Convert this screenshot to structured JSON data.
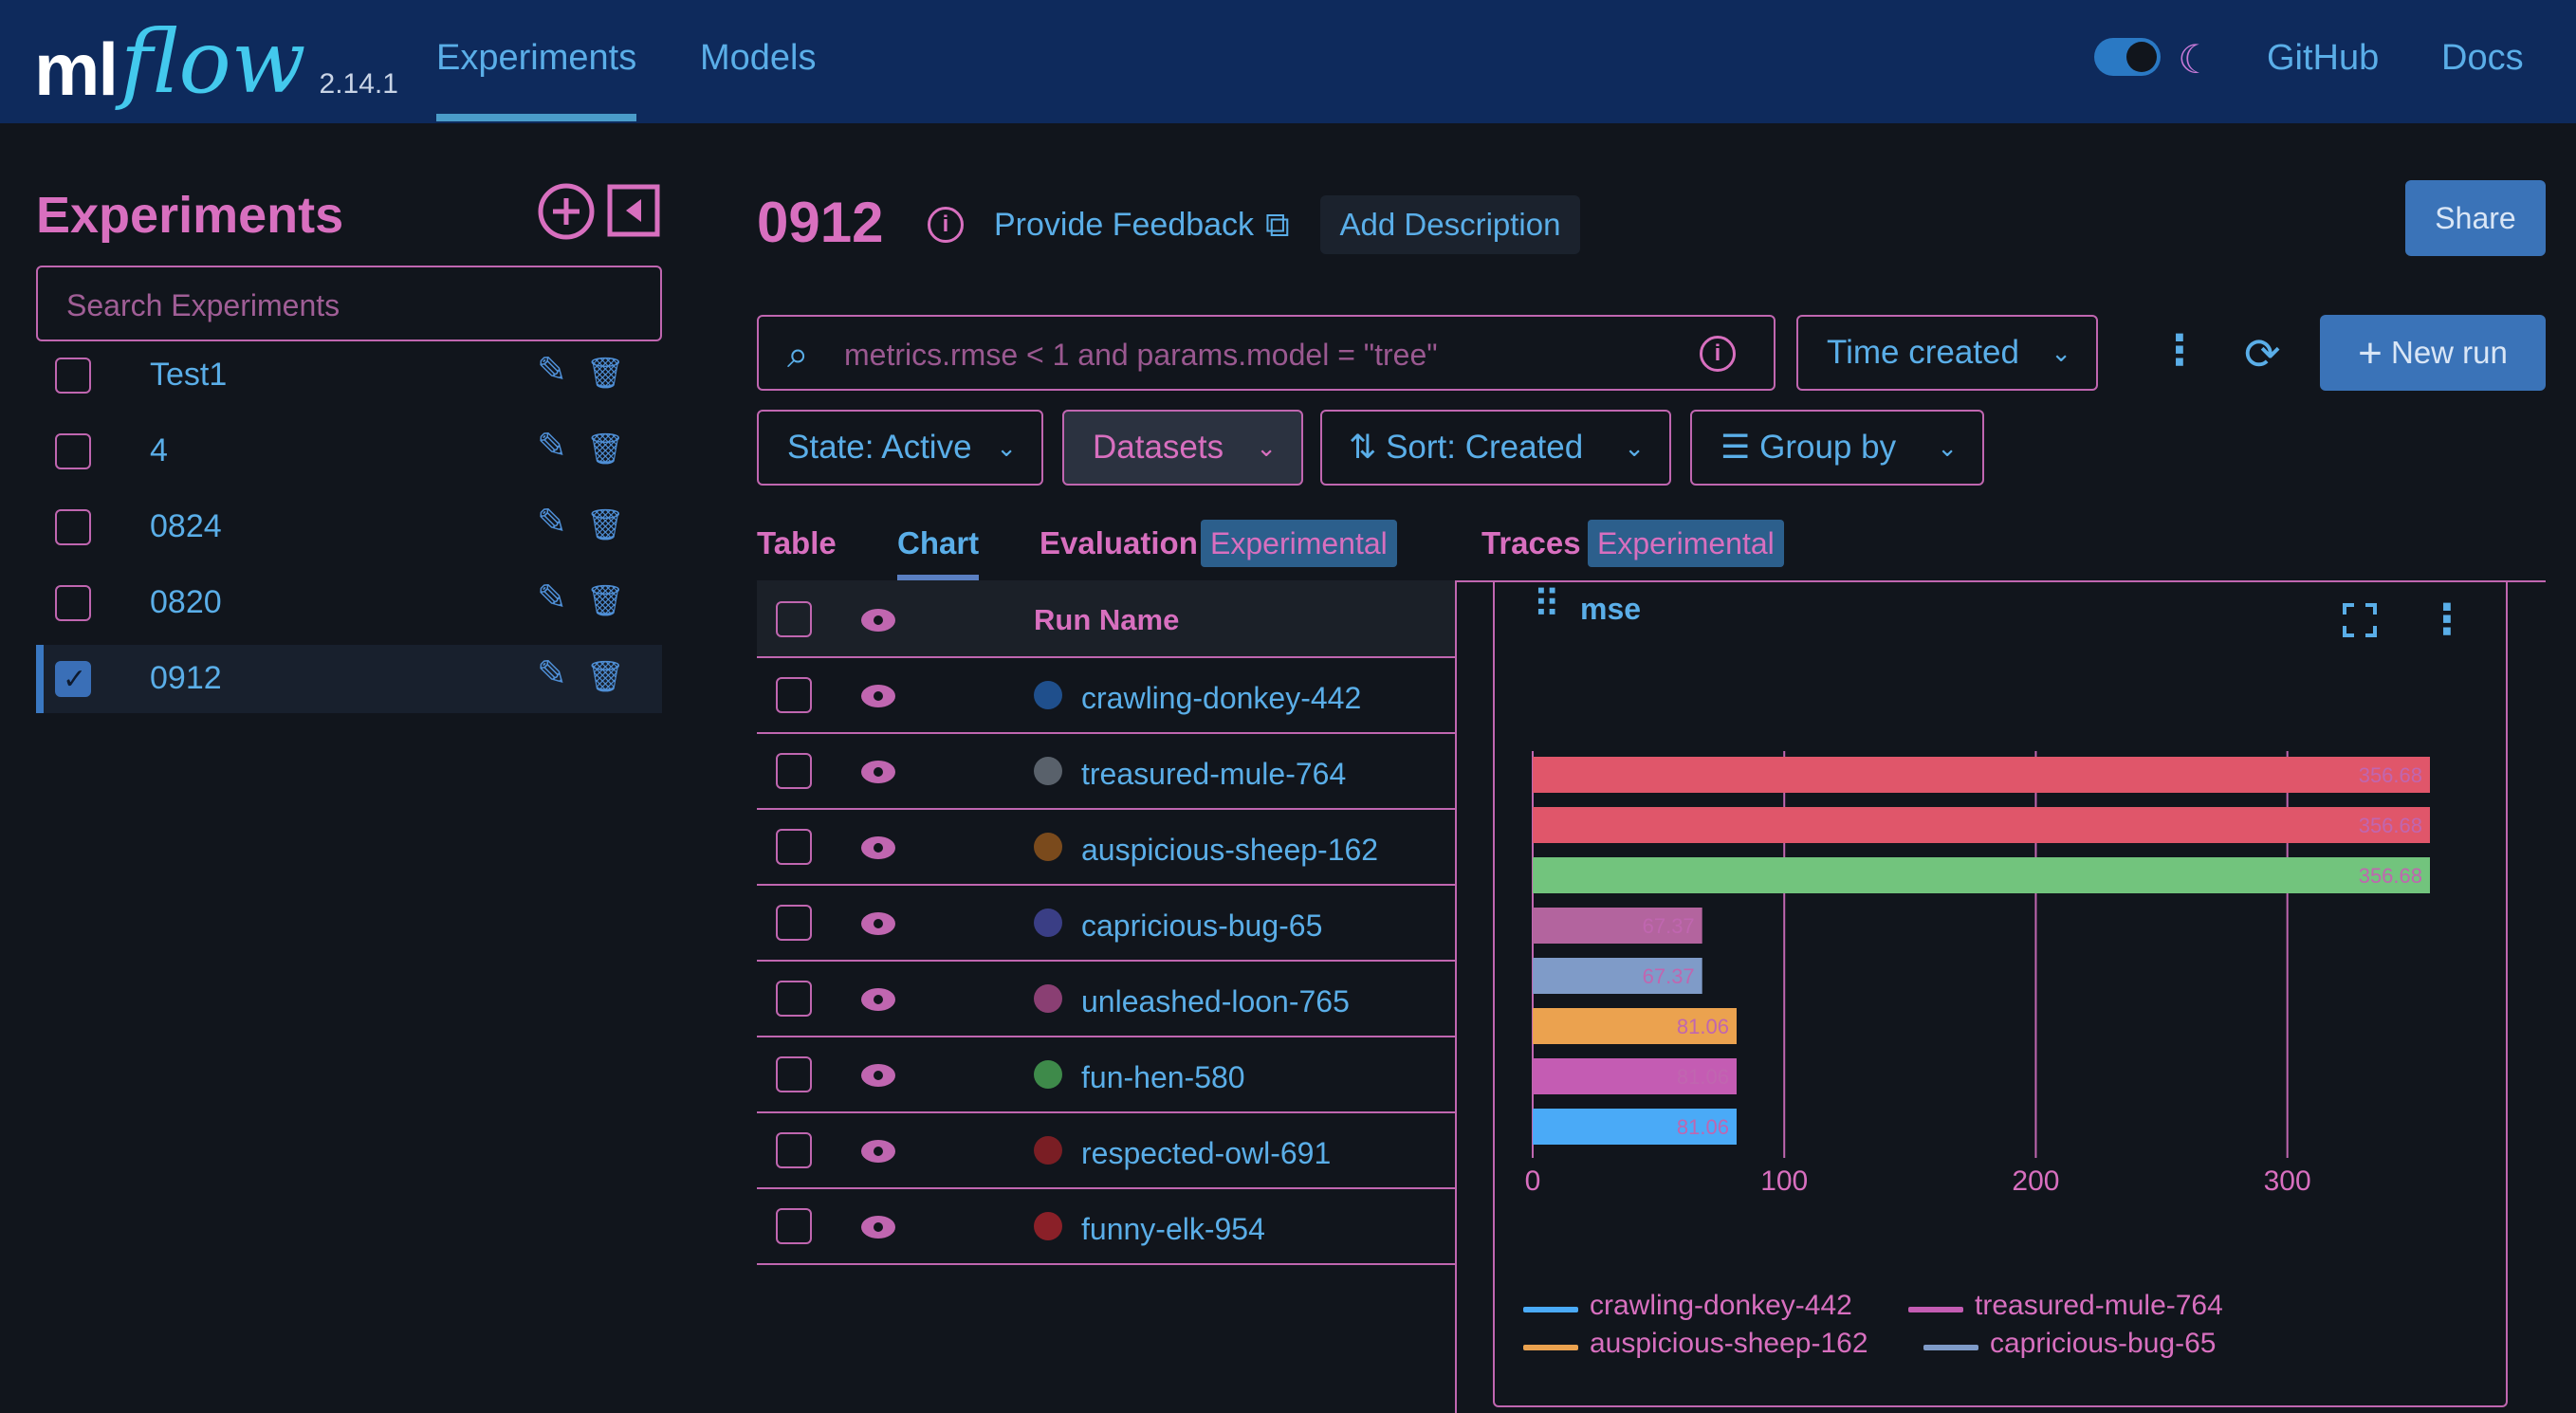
{
  "header": {
    "logo_ml": "ml",
    "logo_flow": "flow",
    "version": "2.14.1",
    "nav": [
      "Experiments",
      "Models"
    ],
    "links": [
      "GitHub",
      "Docs"
    ],
    "theme_toggle_on": true
  },
  "sidebar": {
    "title": "Experiments",
    "search_placeholder": "Search Experiments",
    "items": [
      {
        "label": "Test1",
        "checked": false
      },
      {
        "label": "4",
        "checked": false
      },
      {
        "label": "0824",
        "checked": false
      },
      {
        "label": "0820",
        "checked": false
      },
      {
        "label": "0912",
        "checked": true
      }
    ]
  },
  "main": {
    "title": "0912",
    "feedback_label": "Provide Feedback",
    "add_description_label": "Add Description",
    "share_label": "Share",
    "filter_placeholder": "metrics.rmse < 1 and params.model = \"tree\"",
    "time_created_label": "Time created",
    "new_run_label": "New run",
    "state_label": "State: Active",
    "datasets_label": "Datasets",
    "sort_label": "Sort: Created",
    "group_label": "Group by",
    "tabs": [
      "Table",
      "Chart",
      "Evaluation",
      "Traces"
    ],
    "badge_label": "Experimental",
    "run_name_header": "Run Name",
    "runs": [
      {
        "name": "crawling-donkey-442",
        "color": "#1f4f8c"
      },
      {
        "name": "treasured-mule-764",
        "color": "#59616b"
      },
      {
        "name": "auspicious-sheep-162",
        "color": "#7a4a1c"
      },
      {
        "name": "capricious-bug-65",
        "color": "#3a3e85"
      },
      {
        "name": "unleashed-loon-765",
        "color": "#8a3f73"
      },
      {
        "name": "fun-hen-580",
        "color": "#3e8a4a"
      },
      {
        "name": "respected-owl-691",
        "color": "#7a1e24"
      },
      {
        "name": "funny-elk-954",
        "color": "#8a2028"
      }
    ]
  },
  "chart": {
    "title": "mse"
  },
  "chart_data": {
    "type": "bar",
    "orientation": "horizontal",
    "title": "mse",
    "xlim": [
      0,
      356.68
    ],
    "xticks": [
      0,
      100,
      200,
      300
    ],
    "grid": true,
    "legend_position": "bottom",
    "bars": [
      {
        "value": 356.68,
        "label": "356.68",
        "color": "#e0566a"
      },
      {
        "value": 356.68,
        "label": "356.68",
        "color": "#e0566a"
      },
      {
        "value": 356.68,
        "label": "356.68",
        "color": "#72c47d"
      },
      {
        "value": 67.37,
        "label": "67.37",
        "color": "#b3649e"
      },
      {
        "value": 67.37,
        "label": "67.37",
        "color": "#7f9bc8"
      },
      {
        "value": 81.06,
        "label": "81.06",
        "color": "#eba24f"
      },
      {
        "value": 81.06,
        "label": "81.06",
        "color": "#c45cb3"
      },
      {
        "value": 81.06,
        "label": "81.06",
        "color": "#4aaaf7"
      }
    ],
    "legend": [
      {
        "name": "crawling-donkey-442",
        "color": "#4aaaf7"
      },
      {
        "name": "treasured-mule-764",
        "color": "#c45cb3"
      },
      {
        "name": "auspicious-sheep-162",
        "color": "#eba24f"
      },
      {
        "name": "capricious-bug-65",
        "color": "#7f9bc8"
      }
    ]
  }
}
